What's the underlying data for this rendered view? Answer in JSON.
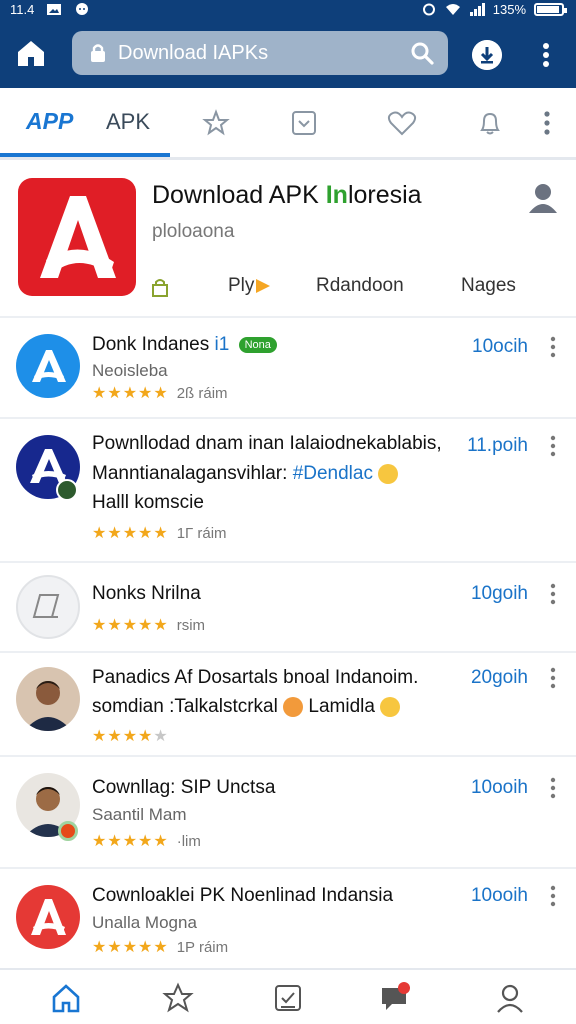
{
  "status_bar": {
    "left_text": "11.4",
    "battery_text": "135%",
    "battery_level": 0.9
  },
  "address_bar": {
    "url": "Download IAPKs"
  },
  "tabs": {
    "app_label": "APP",
    "apk_label": "APK"
  },
  "featured": {
    "title_part1": "Download APK ",
    "title_highlight": "In",
    "title_part2": "loresia",
    "subtitle": "ploloaona",
    "meta_play": "Ply",
    "meta_category": "Rdandoon",
    "meta_pages": "Nages"
  },
  "apps": [
    {
      "title": "Donk Indanes",
      "title_suffix": "i1",
      "badge": "Nona",
      "sub": "Neoisleba",
      "size": "10ocih",
      "rating": 4.5,
      "rating_text": "2ß ráim"
    },
    {
      "title": "Pownllodad dnam inan Ialaiodnekablabis,",
      "line2_prefix": "Manntianalagansvihlar: ",
      "line2_hash": "#Dendlac",
      "line3": "Halll komscie",
      "size": "11.poih",
      "rating": 4.5,
      "rating_text": "1Г ráim"
    },
    {
      "title": "Nonks Nrilna",
      "size": "10goih",
      "rating": 4.5,
      "rating_text": "rsim"
    },
    {
      "title": "Panadics Af Dosartals bnoal Indanoim.",
      "line2_prefix": "somdian :Talkalstcrkal ",
      "line2_suffix": " Lamidla ",
      "size": "20goih",
      "rating": 3.5
    },
    {
      "title": "Cownllag: SIP Unctsa",
      "sub": "Saantil Mam",
      "size": "10ooih",
      "rating": 5,
      "rating_text": "·lim"
    },
    {
      "title": "Cownloaklei PK Noenlinad Indansia",
      "sub": "Unalla Mogna",
      "size": "10ooih",
      "rating": 4.5,
      "rating_text": "1P ráim"
    }
  ],
  "colors": {
    "topbar": "#0e3f7a",
    "accent": "#1976d2",
    "star": "#f2a71b",
    "brand_red": "#e01e26"
  }
}
